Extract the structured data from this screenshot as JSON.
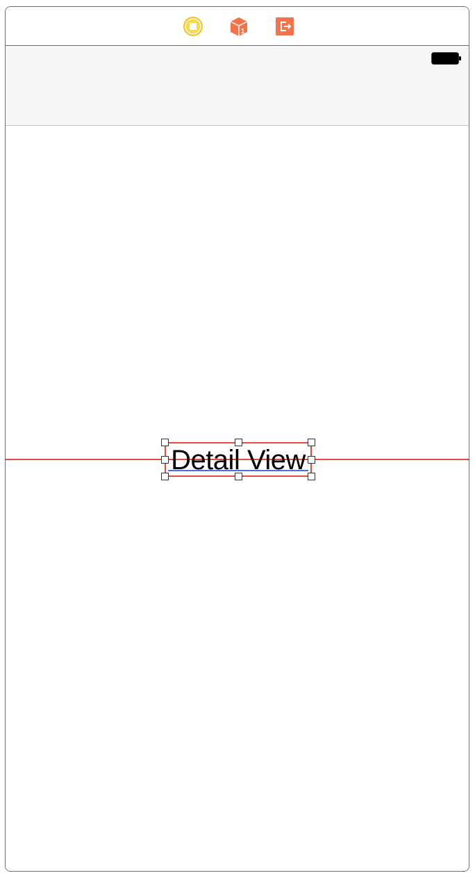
{
  "dock": {
    "icons": [
      "view-controller-icon",
      "first-responder-icon",
      "exit-icon"
    ]
  },
  "status_bar": {
    "battery_icon": "battery-icon"
  },
  "canvas": {
    "label_text": "Detail View"
  },
  "colors": {
    "view_controller": "#f7c31f",
    "first_responder": "#f2734c",
    "exit": "#f2734c",
    "constraint_guide": "#e8493f",
    "baseline": "#4a6ee0"
  }
}
